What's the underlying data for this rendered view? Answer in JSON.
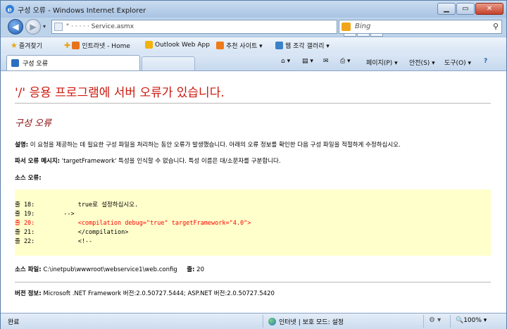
{
  "window": {
    "title": "구성 오류 - Windows Internet Explorer"
  },
  "address": {
    "url": "\"  ·   · ·   · ·   Service.asmx",
    "search_placeholder": "Bing"
  },
  "favorites": {
    "label": "즐겨찾기",
    "items": [
      {
        "label": "인트라넷 - Home"
      },
      {
        "label": "Outlook Web App"
      },
      {
        "label": "추천 사이트 ▾"
      },
      {
        "label": "웹 조각 갤러리 ▾"
      }
    ]
  },
  "tab": {
    "label": "구성 오류"
  },
  "commands": {
    "page": "페이지(P) ▾",
    "safety": "안전(S) ▾",
    "tools": "도구(O) ▾",
    "help": "?"
  },
  "page": {
    "heading": "'/' 응용 프로그램에 서버 오류가 있습니다.",
    "subheading": "구성 오류",
    "description_label": "설명:",
    "description_text": "이 요청을 제공하는 데 필요한 구성 파일을 처리하는 동안 오류가 발생했습니다. 아래의 오류 정보를 확인한 다음 구성 파일을 적절하게 수정하십시오.",
    "parser_label": "파서 오류 메시지:",
    "parser_text": "'targetFramework' 특성을 인식할 수 없습니다. 특성 이름은 대/소문자를 구분합니다.",
    "source_error_label": "소스 오류:",
    "code_lines": [
      {
        "text": "줄 18:            true로 설정하십시오.",
        "error": false
      },
      {
        "text": "줄 19:        -->",
        "error": false
      },
      {
        "text": "줄 20:            <compilation debug=\"true\" targetFramework=\"4.0\">",
        "error": true
      },
      {
        "text": "줄 21:            </compilation>",
        "error": false
      },
      {
        "text": "줄 22:            <!--",
        "error": false
      }
    ],
    "source_file_label": "소스 파일:",
    "source_file_path": "C:\\inetpub\\wwwroot\\webservice1\\web.config",
    "line_label": "줄:",
    "line_number": "20",
    "version_label": "버전 정보:",
    "version_text": "Microsoft .NET Framework 버전:2.0.50727.5444; ASP.NET 버전:2.0.50727.5420"
  },
  "status": {
    "left": "완료",
    "zone": "인터넷 | 보호 모드: 설정",
    "zoom": "🔍100%  ▾"
  }
}
